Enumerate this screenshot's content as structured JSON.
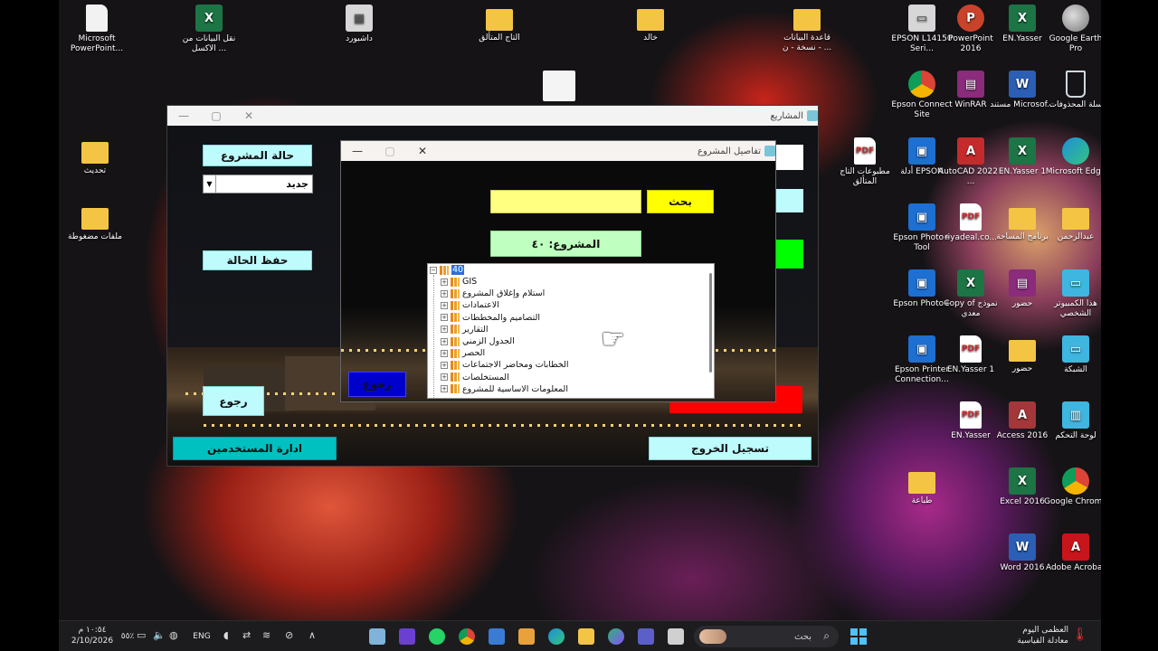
{
  "desktop": {
    "icons": [
      {
        "label": "Microsoft PowerPoint...",
        "icon": "document-icon",
        "glyph": "",
        "style": "g-doc"
      },
      {
        "label": "نقل البيانات من الاكسل ...",
        "icon": "excel-icon",
        "glyph": "X",
        "style": "g-xl"
      },
      {
        "label": "داشبورد",
        "icon": "dashboard-icon",
        "glyph": "▦",
        "style": "g-grey"
      },
      {
        "label": "التاج المتألق",
        "icon": "folder-icon",
        "glyph": "",
        "style": "g-folder"
      },
      {
        "label": "خالد",
        "icon": "folder-icon",
        "glyph": "",
        "style": "g-folder"
      },
      {
        "label": "قاعدة البيانات نسخة - ن - ...",
        "icon": "folder-icon",
        "glyph": "",
        "style": "g-folder"
      },
      {
        "label": "EPSON L14150 Seri...",
        "icon": "printer-icon",
        "glyph": "▭",
        "style": "g-grey"
      },
      {
        "label": "PowerPoint 2016",
        "icon": "powerpoint-icon",
        "glyph": "P",
        "style": "g-ppt"
      },
      {
        "label": "EN.Yasser",
        "icon": "excel-icon",
        "glyph": "X",
        "style": "g-xl"
      },
      {
        "label": "Google Earth Pro",
        "icon": "google-earth-icon",
        "glyph": "",
        "style": "g-earth"
      },
      {
        "label": "تحديث",
        "icon": "folder-icon",
        "glyph": "",
        "style": "g-folder"
      },
      {
        "label": "ملفات مضغوطة",
        "icon": "folder-icon",
        "glyph": "",
        "style": "g-folder"
      },
      {
        "label": "Epson Connect Site",
        "icon": "chrome-icon",
        "glyph": "",
        "style": "g-chrome"
      },
      {
        "label": "WinRAR",
        "icon": "winrar-icon",
        "glyph": "▤",
        "style": "g-rar"
      },
      {
        "label": "مستند Microsof...",
        "icon": "word-icon",
        "glyph": "W",
        "style": "g-word"
      },
      {
        "label": "سلة المحذوفات",
        "icon": "recycle-bin-icon",
        "glyph": "",
        "style": "g-bin"
      },
      {
        "label": "مطبوعات التاج المتألق",
        "icon": "pdf-icon",
        "glyph": "PDF",
        "style": "g-pdf"
      },
      {
        "label": "أدلة EPSON",
        "icon": "epson-manual-icon",
        "glyph": "▣",
        "style": "g-blue"
      },
      {
        "label": "AutoCAD 2022 - ...",
        "icon": "autocad-icon",
        "glyph": "A",
        "style": "g-red"
      },
      {
        "label": "EN.Yasser 1",
        "icon": "excel-icon",
        "glyph": "X",
        "style": "g-xl"
      },
      {
        "label": "Microsoft Edge",
        "icon": "edge-icon",
        "glyph": "",
        "style": "g-edge"
      },
      {
        "label": "Epson Photo+ Tool",
        "icon": "epson-photo-icon",
        "glyph": "▣",
        "style": "g-blue"
      },
      {
        "label": "riyadeal.co...",
        "icon": "pdf-icon",
        "glyph": "PDF",
        "style": "g-pdf"
      },
      {
        "label": "برنامج المساحة",
        "icon": "folder-icon",
        "glyph": "",
        "style": "g-folder"
      },
      {
        "label": "عبدالرحمن",
        "icon": "user-folder-icon",
        "glyph": "",
        "style": "g-folder"
      },
      {
        "label": "Epson Photo+",
        "icon": "epson-photo-icon",
        "glyph": "▣",
        "style": "g-blue"
      },
      {
        "label": "Copy of نموذج معدي",
        "icon": "excel-icon",
        "glyph": "X",
        "style": "g-xl"
      },
      {
        "label": "حضور",
        "icon": "winrar-icon",
        "glyph": "▤",
        "style": "g-rar"
      },
      {
        "label": "هذا الكمبيوتر الشخصي",
        "icon": "computer-icon",
        "glyph": "▭",
        "style": "g-cyan"
      },
      {
        "label": "Epson Printer Connection...",
        "icon": "epson-printer-icon",
        "glyph": "▣",
        "style": "g-blue"
      },
      {
        "label": "EN.Yasser 1",
        "icon": "pdf-icon",
        "glyph": "PDF",
        "style": "g-pdf"
      },
      {
        "label": "حضور",
        "icon": "folder-icon",
        "glyph": "",
        "style": "g-folder"
      },
      {
        "label": "الشبكة",
        "icon": "network-icon",
        "glyph": "▭",
        "style": "g-cyan"
      },
      {
        "label": "EN.Yasser",
        "icon": "pdf-icon",
        "glyph": "PDF",
        "style": "g-pdf"
      },
      {
        "label": "Access 2016",
        "icon": "access-icon",
        "glyph": "A",
        "style": "g-access"
      },
      {
        "label": "لوحة التحكم",
        "icon": "control-panel-icon",
        "glyph": "▥",
        "style": "g-cyan"
      },
      {
        "label": "طباعة",
        "icon": "folder-icon",
        "glyph": "",
        "style": "g-folder"
      },
      {
        "label": "Excel 2016",
        "icon": "excel-icon",
        "glyph": "X",
        "style": "g-xl"
      },
      {
        "label": "Google Chrome",
        "icon": "chrome-icon",
        "glyph": "",
        "style": "g-chrome"
      },
      {
        "label": "Word 2016",
        "icon": "word-icon",
        "glyph": "W",
        "style": "g-word"
      },
      {
        "label": "Adobe Acrobat",
        "icon": "acrobat-icon",
        "glyph": "A",
        "style": "g-acrobat"
      }
    ]
  },
  "main_window": {
    "title": "المشاريع",
    "status_label": "حالة المشروع",
    "status_value": "جديد",
    "save_status": "حفظ الحالة",
    "back": "رجوع",
    "user_admin": "ادارة المستخدمين",
    "logout": "تسجيل الخروج",
    "colors": {
      "cyan": "#bdfbfd",
      "green": "#00ff00",
      "red": "#ff0000",
      "blue": "#0000cc",
      "teal": "#00c0c0"
    }
  },
  "detail_window": {
    "title": "تفاصيل المشروع",
    "search_button": "بحث",
    "search_value": "",
    "project_label": "المشروع: ٤٠",
    "back": "رجوع",
    "tree": {
      "root": "40",
      "items": [
        "GIS",
        "استلام وإغلاق المشروع",
        "الاعتمادات",
        "التصاميم والمخططات",
        "التقارير",
        "الجدول الزمني",
        "الحصر",
        "الخطابات ومحاضر الاجتماعات",
        "المستخلصات",
        "المعلومات الاساسية للمشروع"
      ]
    }
  },
  "taskbar": {
    "search_placeholder": "بحث",
    "weather_line1": "العظمى اليوم",
    "weather_line2": "معادلة القياسية",
    "language": "ENG",
    "battery": "٥٥٪",
    "time": "١٠:٥٤ م",
    "date": "2/10/2026"
  }
}
